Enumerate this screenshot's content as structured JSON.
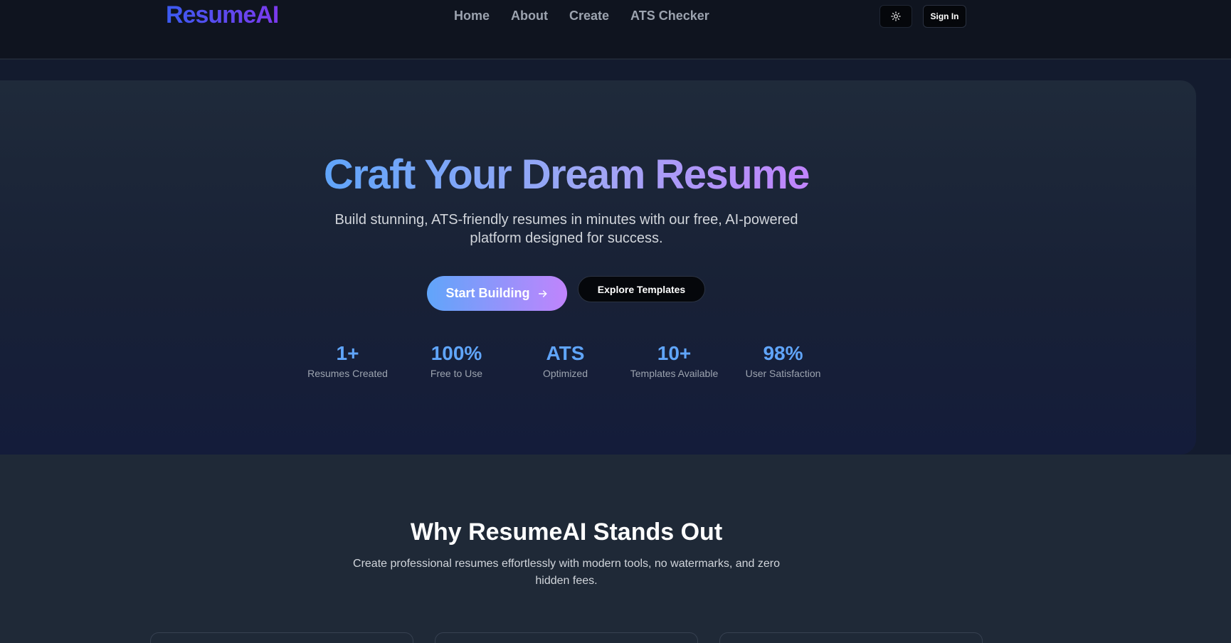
{
  "header": {
    "logo": "ResumeAI",
    "nav": [
      "Home",
      "About",
      "Create",
      "ATS Checker"
    ],
    "theme_toggle_icon": "sun-icon",
    "sign_in": "Sign In"
  },
  "hero": {
    "title": "Craft Your Dream Resume",
    "subtitle": "Build stunning, ATS-friendly resumes in minutes with our free, AI-powered platform designed for success.",
    "primary_cta": "Start Building",
    "primary_cta_icon": "arrow-right-icon",
    "secondary_cta": "Explore Templates",
    "stats": [
      {
        "value": "1+",
        "label": "Resumes Created"
      },
      {
        "value": "100%",
        "label": "Free to Use"
      },
      {
        "value": "ATS",
        "label": "Optimized"
      },
      {
        "value": "10+",
        "label": "Templates Available"
      },
      {
        "value": "98%",
        "label": "User Satisfaction"
      }
    ]
  },
  "features": {
    "title": "Why ResumeAI Stands Out",
    "subtitle": "Create professional resumes effortlessly with modern tools, no watermarks, and zero hidden fees."
  },
  "colors": {
    "accent_blue": "#60a5fa",
    "accent_purple": "#c084fc",
    "background": "#1f2937",
    "header": "#0f141f"
  }
}
